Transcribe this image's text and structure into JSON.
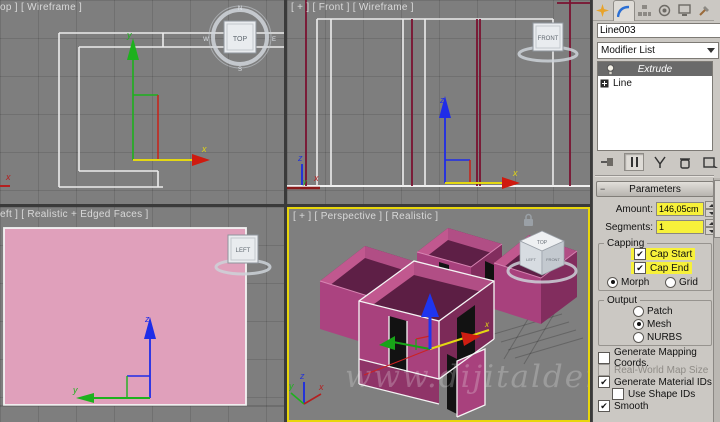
{
  "viewports": {
    "top": {
      "label": "op ] [ Wireframe ]"
    },
    "front": {
      "label": "[ + ] [ Front ] [ Wireframe ]"
    },
    "left": {
      "label": "eft ] [ Realistic + Edged Faces ]"
    },
    "perspective": {
      "label": "[ + ] [ Perspective ] [ Realistic ]"
    }
  },
  "viewcube": {
    "top": "TOP",
    "front": "FRONT",
    "left": "LEFT",
    "persp_top": "TOP",
    "persp_front": "FRONT",
    "persp_left": "LEFT",
    "compass": {
      "n": "N",
      "e": "E",
      "s": "S",
      "w": "W"
    }
  },
  "axis": {
    "x": "x",
    "y": "y",
    "z": "z"
  },
  "watermark": "www.dijitalders",
  "panel": {
    "object_name": "Line003",
    "object_color": "#8e1b4a",
    "modifier_list_label": "Modifier List",
    "stack": [
      {
        "label": "Extrude",
        "selected": true
      },
      {
        "label": "Line"
      }
    ],
    "params": {
      "title": "Parameters",
      "amount_label": "Amount:",
      "amount_value": "146,05cm",
      "segments_label": "Segments:",
      "segments_value": "1",
      "capping_title": "Capping",
      "cap_start": "Cap Start",
      "cap_end": "Cap End",
      "morph": "Morph",
      "grid": "Grid",
      "output_title": "Output",
      "patch": "Patch",
      "mesh": "Mesh",
      "nurbs": "NURBS",
      "checks": [
        {
          "label": "Generate Mapping Coords.",
          "checked": false
        },
        {
          "label": "Real-World Map Size",
          "checked": false,
          "disabled": true
        },
        {
          "label": "Generate Material IDs",
          "checked": true
        },
        {
          "label": "Use Shape IDs",
          "checked": false,
          "indent": true
        },
        {
          "label": "Smooth",
          "checked": true
        }
      ]
    }
  },
  "icons": {
    "create": "sunburst",
    "modify": "blue-arc",
    "hierarchy": "linked-boxes",
    "motion": "concentric-circles",
    "display": "monitor",
    "utilities": "hammer",
    "check": "✔",
    "chevron_down": "▼",
    "lock": "padlock"
  },
  "colors": {
    "highlight": "#f7f13a",
    "active_viewport_border": "#e8d60c",
    "wall_pink": "#e0a0bb",
    "wall_magenta": "#a8417d",
    "selection_edge": "#ffffff"
  }
}
